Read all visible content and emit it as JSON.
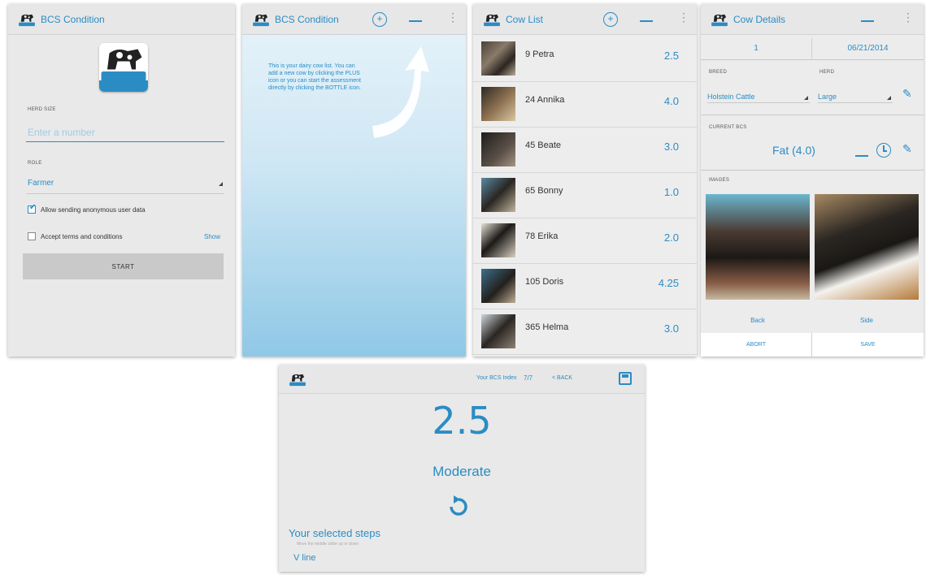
{
  "p1": {
    "title": "BCS Condition",
    "herd_label": "HERD SIZE",
    "herd_placeholder": "Enter a number",
    "role_label": "ROLE",
    "role_value": "Farmer",
    "allow_label": "Allow sending anonymous user data",
    "terms_label": "Accept terms and conditions",
    "show_label": "Show",
    "start_label": "START"
  },
  "p2": {
    "title": "BCS Condition",
    "hint": "This is your dairy cow list. You can add a new cow by clicking the PLUS icon or you can start the assessment directly by clicking the BOTTLE icon."
  },
  "p3": {
    "title": "Cow List",
    "cows": [
      {
        "name": "9 Petra",
        "score": "2.5"
      },
      {
        "name": "24 Annika",
        "score": "4.0"
      },
      {
        "name": "45 Beate",
        "score": "3.0"
      },
      {
        "name": "65 Bonny",
        "score": "1.0"
      },
      {
        "name": "78 Erika",
        "score": "2.0"
      },
      {
        "name": "105 Doris",
        "score": "4.25"
      },
      {
        "name": "365 Helma",
        "score": "3.0"
      }
    ]
  },
  "p4": {
    "title": "Cow Details",
    "tab_number": "1",
    "tab_date": "06/21/2014",
    "breed_label": "BREED",
    "breed_value": "Holstein Cattle",
    "herd_label": "HERD",
    "herd_value": "Large",
    "current_label": "CURRENT BCS",
    "current_value": "Fat (4.0)",
    "images_label": "IMAGES",
    "back_label": "Back",
    "side_label": "Side",
    "abort_label": "ABORT",
    "save_label": "SAVE"
  },
  "p5": {
    "index_label": "Your BCS Index",
    "step": "7/7",
    "back_label": "< BACK",
    "score": "2.5",
    "condition": "Moderate",
    "steps_title": "Your selected steps",
    "steps_sub": "Move the middle slider up or down",
    "steps_item": "V line"
  },
  "colors": {
    "accent": "#2b8cc4",
    "panel": "#e9e9e9"
  }
}
